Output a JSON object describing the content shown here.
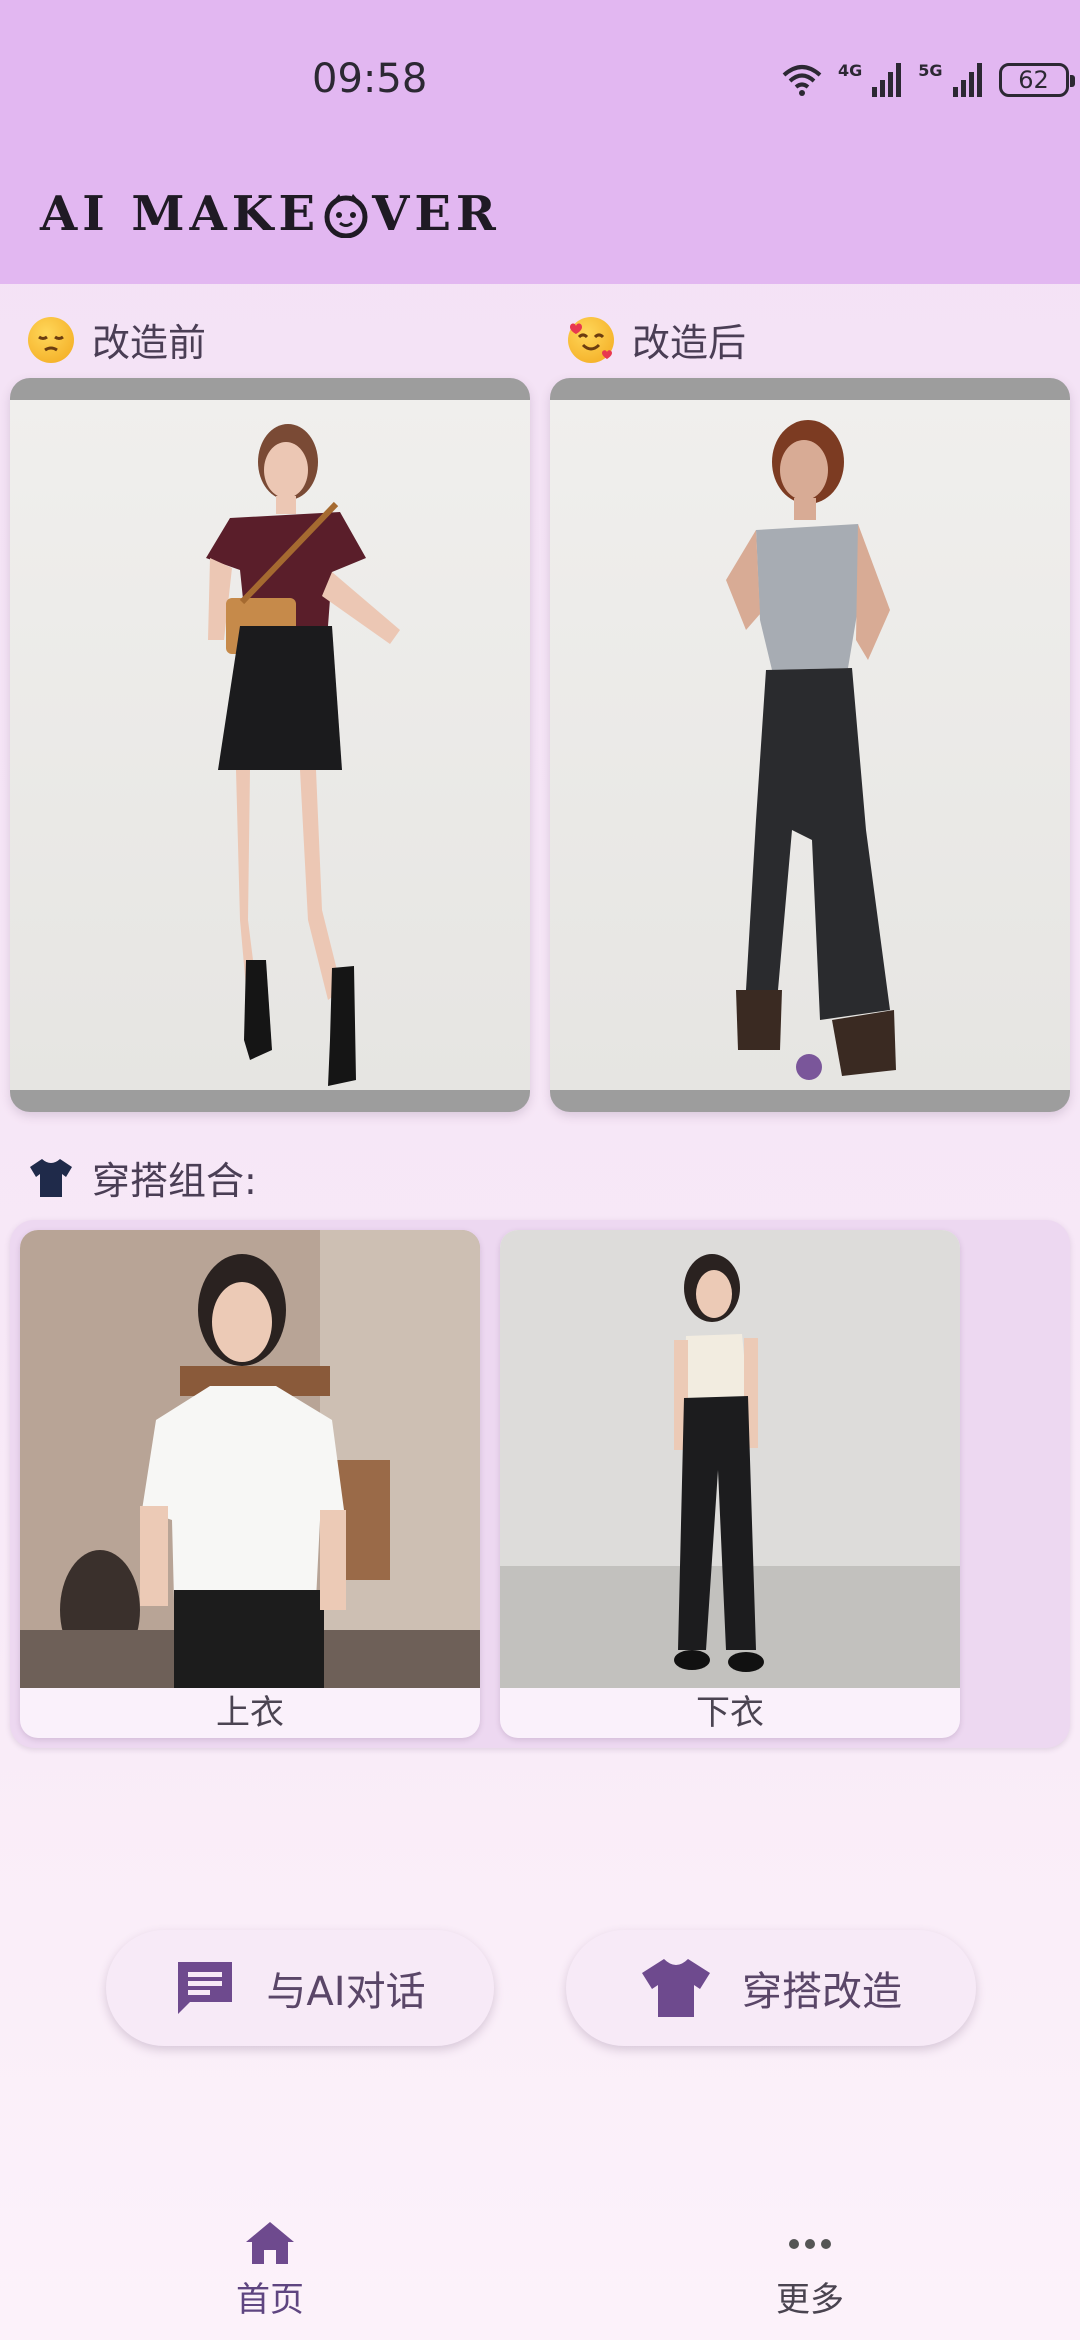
{
  "status_bar": {
    "time": "09:58",
    "net1": "4G",
    "net2": "5G",
    "battery": "62"
  },
  "header": {
    "title_part1": "AI MAKE",
    "title_part2": "VER"
  },
  "before": {
    "label": "改造前",
    "emoji": "sleepy-face"
  },
  "after": {
    "label": "改造后",
    "emoji": "smiling-face-with-hearts"
  },
  "combo": {
    "label": "穿搭组合:",
    "items": [
      {
        "label": "上衣"
      },
      {
        "label": "下衣"
      }
    ]
  },
  "actions": {
    "chat_label": "与AI对话",
    "makeover_label": "穿搭改造"
  },
  "nav": {
    "home_label": "首页",
    "more_label": "更多"
  },
  "colors": {
    "header_bg": "#e2b7f1",
    "accent": "#7a569a",
    "panel_bg": "#edd8f1"
  }
}
